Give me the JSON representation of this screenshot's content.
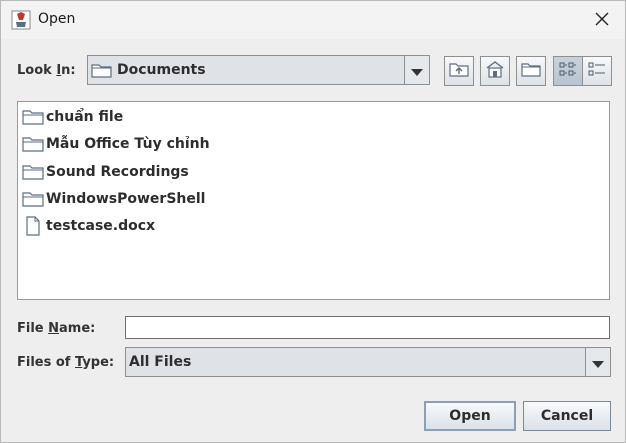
{
  "window": {
    "title": "Open",
    "close_glyph": "✕"
  },
  "look_in": {
    "label_prefix": "Look ",
    "label_mnemonic": "I",
    "label_suffix": "n:",
    "value": "Documents",
    "icon": "folder-icon"
  },
  "toolbar": {
    "buttons": [
      {
        "name": "up-one-level",
        "icon": "up-folder-icon"
      },
      {
        "name": "home",
        "icon": "home-icon"
      },
      {
        "name": "new-folder",
        "icon": "new-folder-icon"
      },
      {
        "name": "list-view",
        "icon": "list-view-icon",
        "pressed": true
      },
      {
        "name": "details-view",
        "icon": "details-view-icon",
        "pressed": false
      }
    ]
  },
  "files": [
    {
      "name": "chuẩn file",
      "type": "folder"
    },
    {
      "name": "Mẫu Office Tùy chỉnh",
      "type": "folder"
    },
    {
      "name": "Sound Recordings",
      "type": "folder"
    },
    {
      "name": "WindowsPowerShell",
      "type": "folder"
    },
    {
      "name": "testcase.docx",
      "type": "file"
    }
  ],
  "file_name": {
    "label_prefix": "File ",
    "label_mnemonic": "N",
    "label_suffix": "ame:",
    "value": ""
  },
  "files_of_type": {
    "label_prefix": "Files of ",
    "label_mnemonic": "T",
    "label_suffix": "ype:",
    "value": "All Files"
  },
  "actions": {
    "open_label": "Open",
    "cancel_label": "Cancel"
  },
  "colors": {
    "dialog_bg": "#eeeeee",
    "combo_bg": "#dfe3e8",
    "folder_icon": "#5a6e82"
  }
}
